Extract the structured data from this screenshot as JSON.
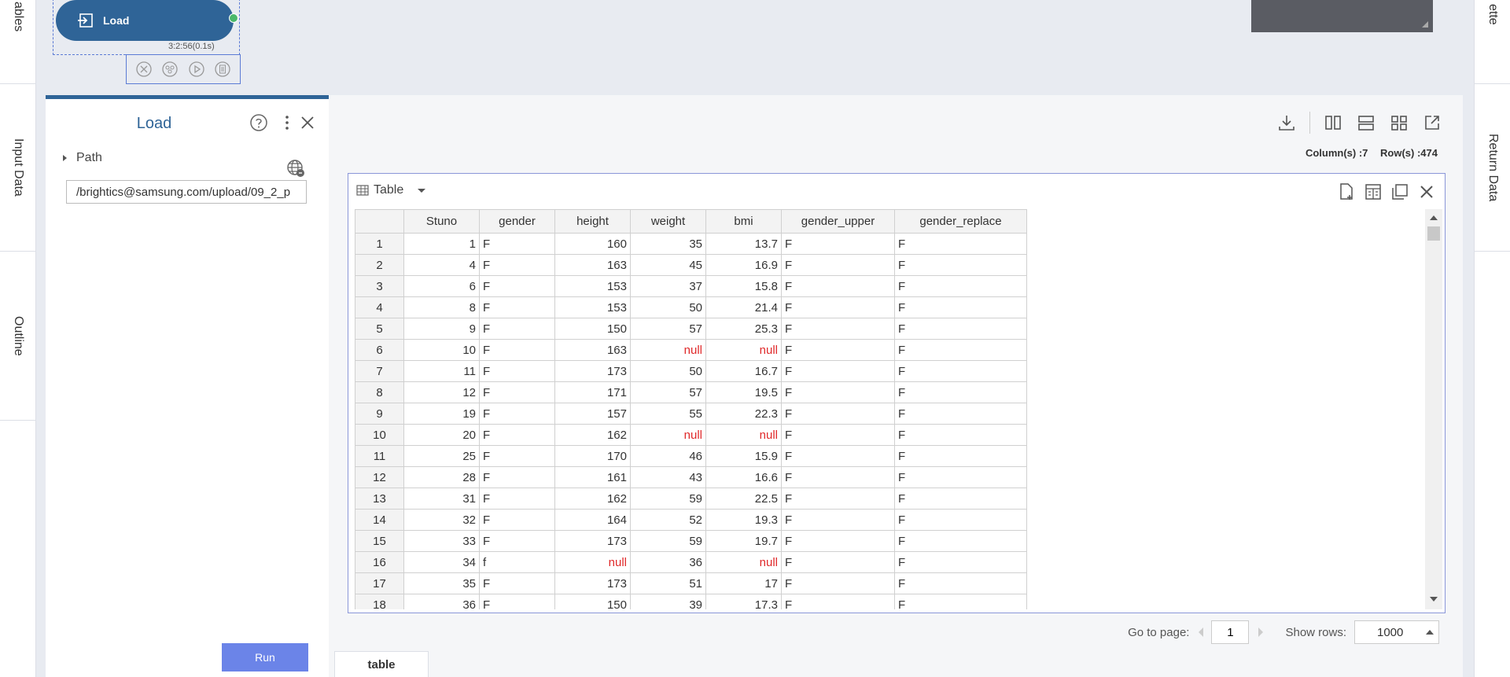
{
  "left_tabs": [
    "ables",
    "Input Data",
    "Outline"
  ],
  "right_tabs": [
    "ette",
    "Return Data"
  ],
  "node": {
    "label": "Load",
    "time": "3:2:56(0.1s)"
  },
  "panel": {
    "title": "Load",
    "path_label": "Path",
    "path_value": "/brightics@samsung.com/upload/09_2_p",
    "run_label": "Run"
  },
  "output": {
    "columns_count": "Column(s) :7",
    "rows_count": "Row(s) :474",
    "table_label": "Table",
    "go_to_page_label": "Go to page:",
    "page_value": "1",
    "show_rows_label": "Show rows:",
    "show_rows_value": "1000",
    "bottom_tab": "table"
  },
  "table": {
    "columns": [
      "Stuno",
      "gender",
      "height",
      "weight",
      "bmi",
      "gender_upper",
      "gender_replace"
    ],
    "rows": [
      [
        "1",
        "1",
        "F",
        "160",
        "35",
        "13.7",
        "F",
        "F"
      ],
      [
        "2",
        "4",
        "F",
        "163",
        "45",
        "16.9",
        "F",
        "F"
      ],
      [
        "3",
        "6",
        "F",
        "153",
        "37",
        "15.8",
        "F",
        "F"
      ],
      [
        "4",
        "8",
        "F",
        "153",
        "50",
        "21.4",
        "F",
        "F"
      ],
      [
        "5",
        "9",
        "F",
        "150",
        "57",
        "25.3",
        "F",
        "F"
      ],
      [
        "6",
        "10",
        "F",
        "163",
        "null",
        "null",
        "F",
        "F"
      ],
      [
        "7",
        "11",
        "F",
        "173",
        "50",
        "16.7",
        "F",
        "F"
      ],
      [
        "8",
        "12",
        "F",
        "171",
        "57",
        "19.5",
        "F",
        "F"
      ],
      [
        "9",
        "19",
        "F",
        "157",
        "55",
        "22.3",
        "F",
        "F"
      ],
      [
        "10",
        "20",
        "F",
        "162",
        "null",
        "null",
        "F",
        "F"
      ],
      [
        "11",
        "25",
        "F",
        "170",
        "46",
        "15.9",
        "F",
        "F"
      ],
      [
        "12",
        "28",
        "F",
        "161",
        "43",
        "16.6",
        "F",
        "F"
      ],
      [
        "13",
        "31",
        "F",
        "162",
        "59",
        "22.5",
        "F",
        "F"
      ],
      [
        "14",
        "32",
        "F",
        "164",
        "52",
        "19.3",
        "F",
        "F"
      ],
      [
        "15",
        "33",
        "F",
        "173",
        "59",
        "19.7",
        "F",
        "F"
      ],
      [
        "16",
        "34",
        "f",
        "null",
        "36",
        "null",
        "F",
        "F"
      ],
      [
        "17",
        "35",
        "F",
        "173",
        "51",
        "17",
        "F",
        "F"
      ],
      [
        "18",
        "36",
        "F",
        "150",
        "39",
        "17.3",
        "F",
        "F"
      ]
    ]
  },
  "colors": {
    "accent": "#2f6497",
    "run": "#6b84e8",
    "null": "#e0292a",
    "port": "#4ab86a"
  }
}
